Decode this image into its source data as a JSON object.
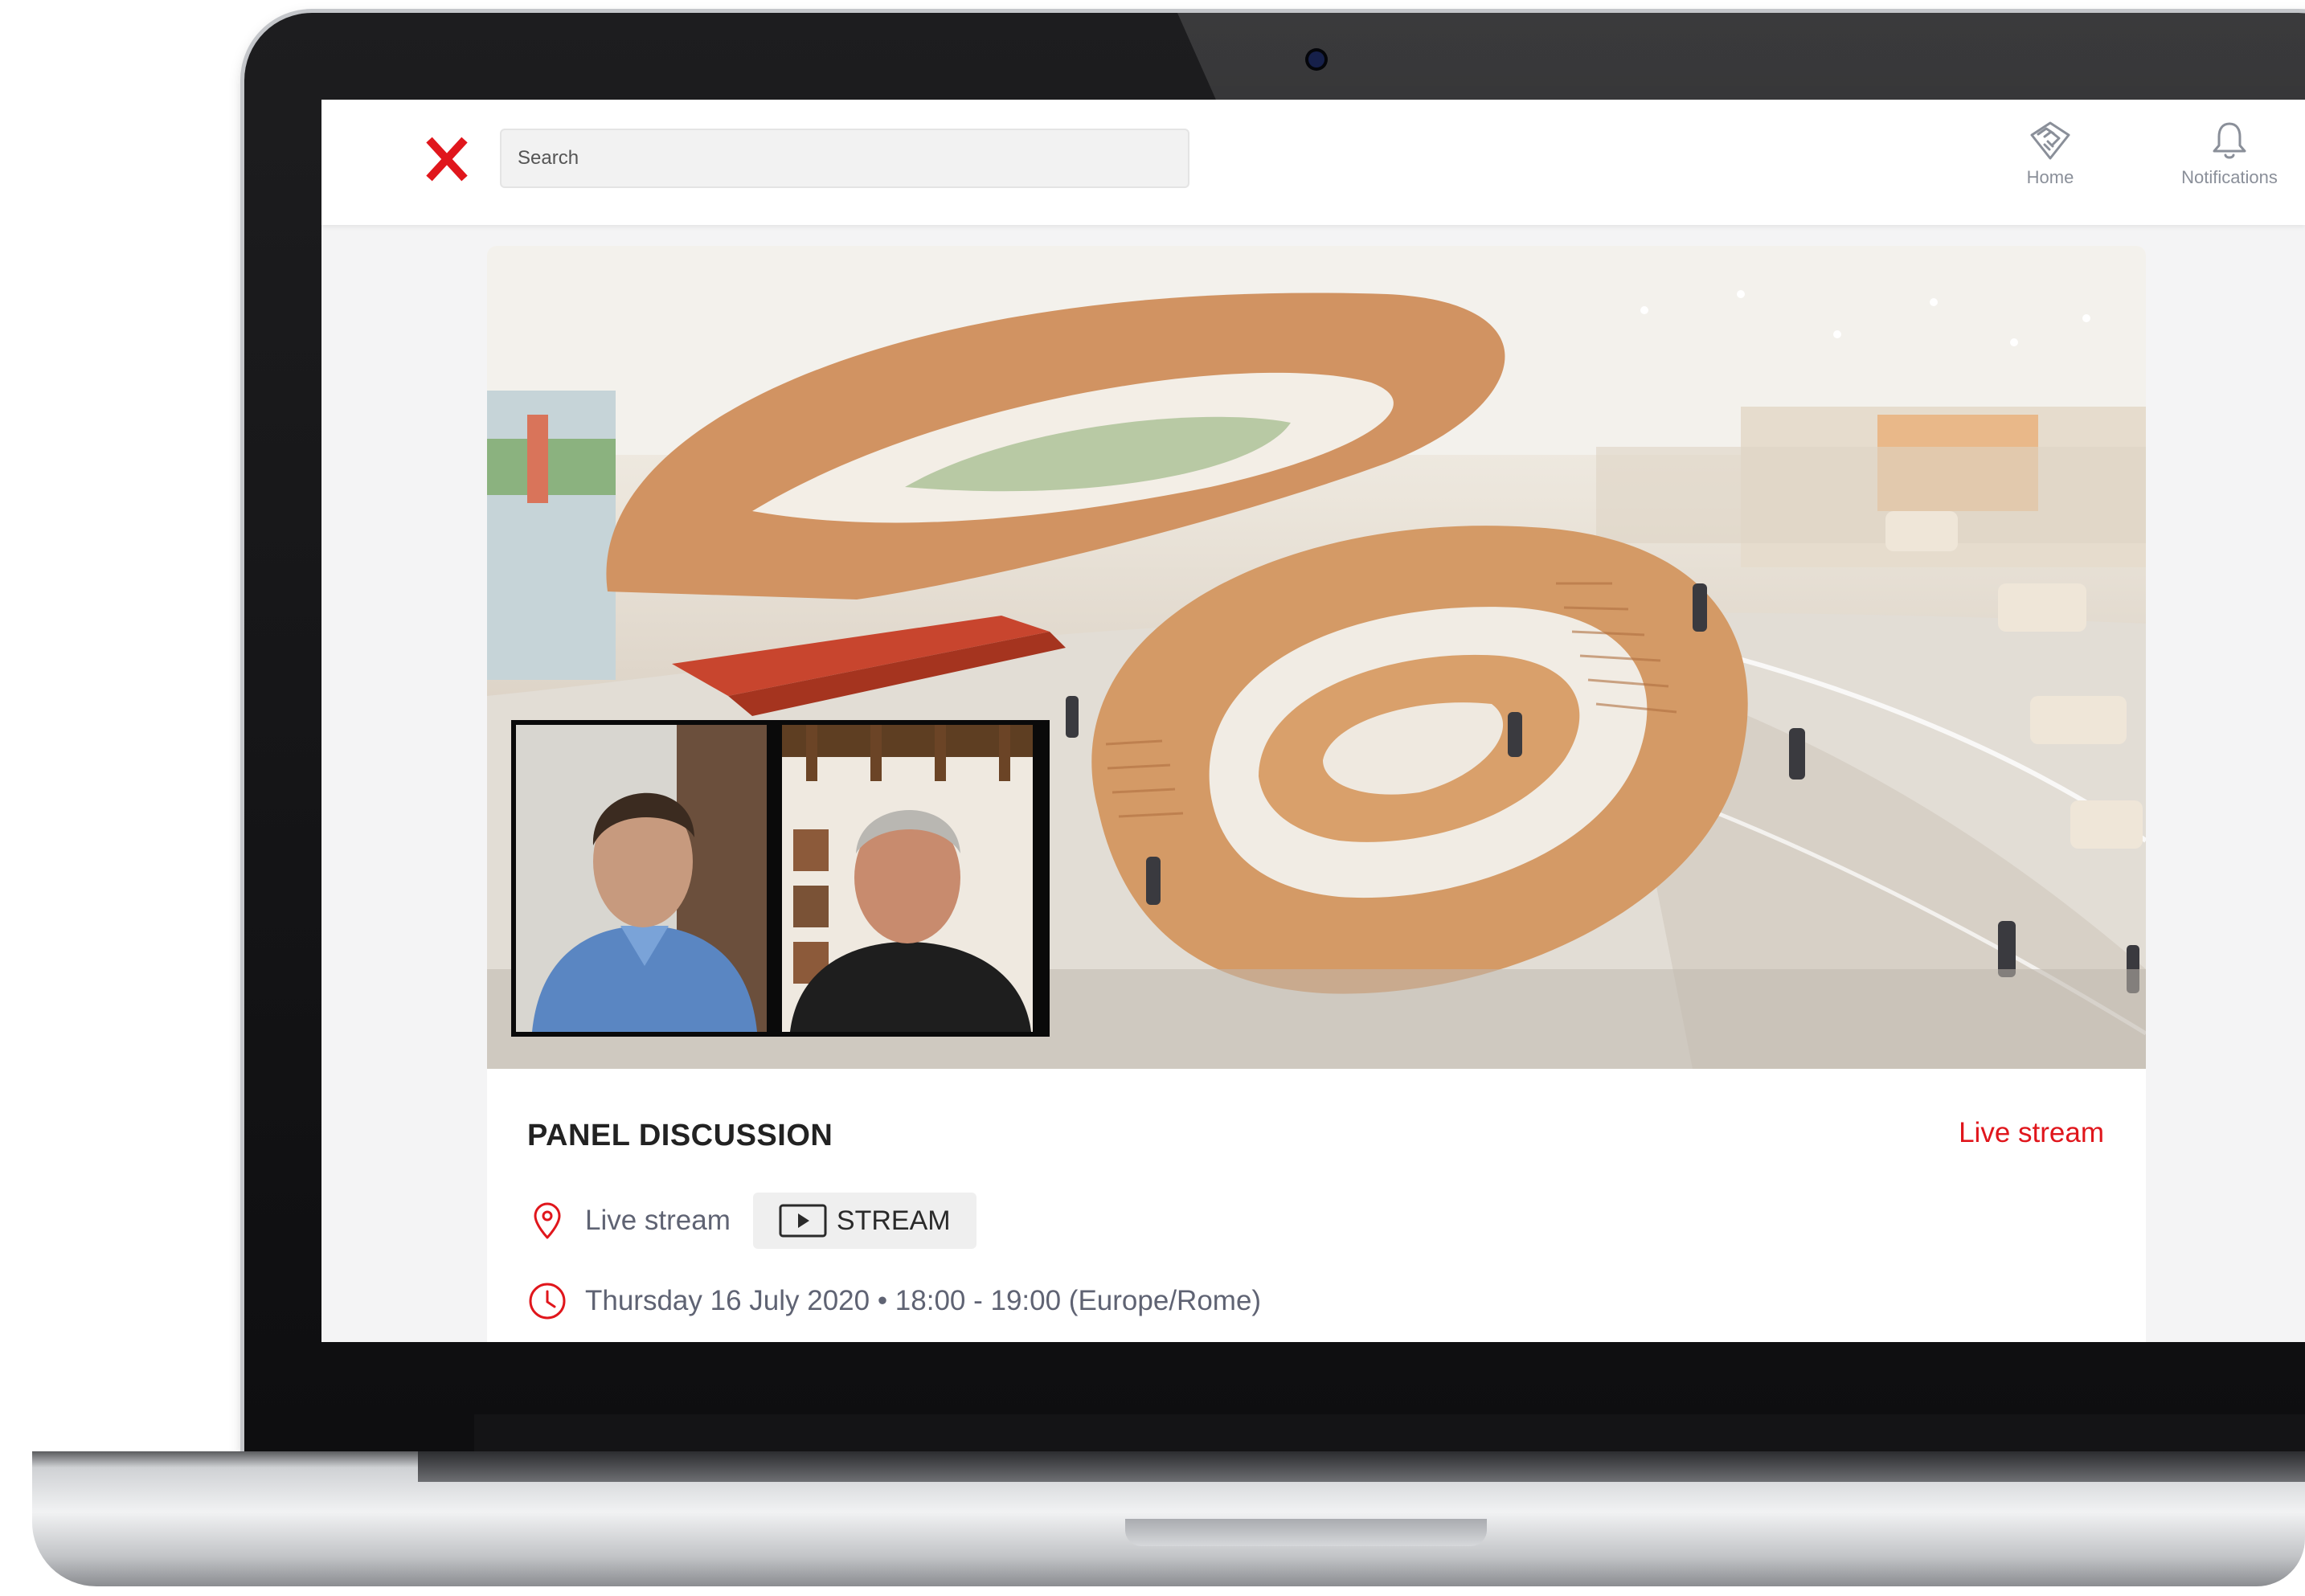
{
  "header": {
    "search": {
      "placeholder": "Search"
    },
    "nav": [
      {
        "label": "Home",
        "icon": "handshake-icon"
      },
      {
        "label": "Notifications",
        "icon": "bell-icon"
      }
    ]
  },
  "event": {
    "title": "PANEL DISCUSSION",
    "type": "Live stream",
    "location": "Live stream",
    "stream_button": "STREAM",
    "datetime": "Thursday 16 July 2020 • 18:00 - 19:00 (Europe/Rome)"
  },
  "colors": {
    "accent": "#e0161c",
    "muted_text": "#5f6373",
    "nav_text": "#8a8f99"
  }
}
